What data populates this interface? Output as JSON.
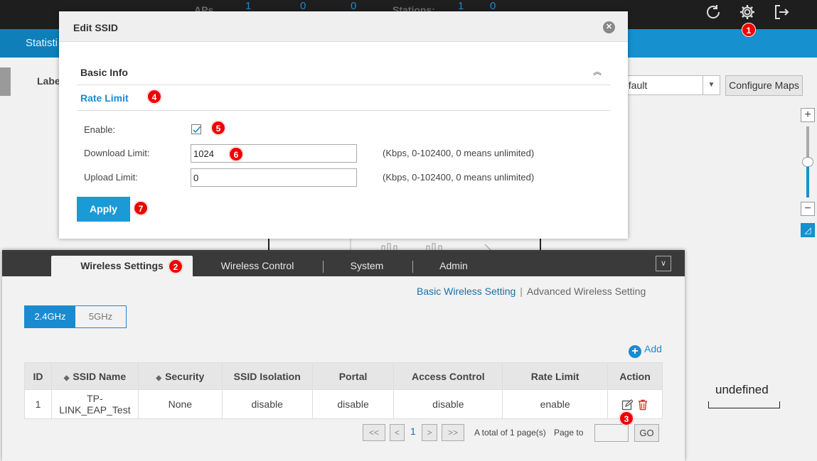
{
  "topbar": {
    "aps_label": "APs",
    "aps_counts": [
      "1",
      "0",
      "0"
    ],
    "stations_label": "Stations:",
    "stations_counts": [
      "1",
      "0"
    ],
    "icons": [
      "refresh-icon",
      "gear-icon",
      "logout-icon"
    ]
  },
  "nav": {
    "statistics_tab": "Statisti"
  },
  "map": {
    "label_text": "Labe",
    "map_select_value": "efault",
    "configure_maps": "Configure Maps",
    "zoom_in": "+",
    "zoom_out": "−",
    "scale_text": "undefined"
  },
  "modal": {
    "title": "Edit SSID",
    "basic_info": "Basic Info",
    "rate_limit": "Rate Limit",
    "enable_label": "Enable:",
    "enable_checked": true,
    "download_label": "Download Limit:",
    "download_value": "1024",
    "download_hint": "(Kbps, 0-102400, 0 means unlimited)",
    "upload_label": "Upload Limit:",
    "upload_value": "0",
    "upload_hint": "(Kbps, 0-102400, 0 means unlimited)",
    "apply": "Apply"
  },
  "badges": [
    "1",
    "2",
    "3",
    "4",
    "5",
    "6",
    "7"
  ],
  "panel": {
    "tabs": [
      "Wireless Settings",
      "Wireless Control",
      "System",
      "Admin"
    ],
    "active_tab": "Wireless Settings",
    "sublinks": [
      "Basic Wireless Setting",
      "Advanced Wireless Setting"
    ],
    "bands": [
      "2.4GHz",
      "5GHz"
    ],
    "add": "Add",
    "table": {
      "headers": [
        "ID",
        "SSID Name",
        "Security",
        "SSID Isolation",
        "Portal",
        "Access Control",
        "Rate Limit",
        "Action"
      ],
      "rows": [
        [
          "1",
          "TP-LINK_EAP_Test",
          "None",
          "disable",
          "disable",
          "disable",
          "enable"
        ]
      ]
    },
    "pager": {
      "first": "<<",
      "prev": "<",
      "current": "1",
      "next": ">",
      "last": ">>",
      "total_text": "A total of 1 page(s)",
      "page_to": "Page to",
      "go": "GO"
    }
  },
  "colors": {
    "accent": "#1a8bd0",
    "badge": "#e00000",
    "topbar": "#1e1e1e"
  }
}
